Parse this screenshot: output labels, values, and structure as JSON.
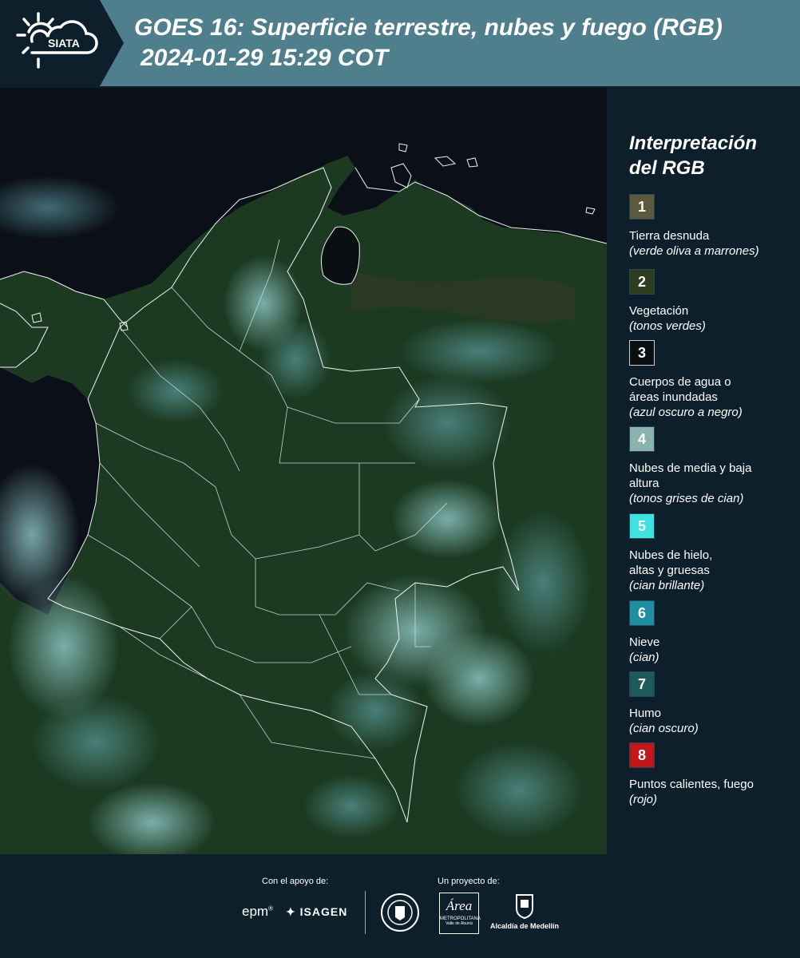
{
  "header": {
    "logo_text": "SIATA",
    "title_line1": "GOES 16: Superficie terrestre, nubes y fuego (RGB)",
    "title_line2": "2024-01-29 15:29 COT"
  },
  "legend": {
    "title_line1": "Interpretación",
    "title_line2": "del RGB",
    "items": [
      {
        "number": "1",
        "color": "#5c5a3e",
        "label": "Tierra desnuda",
        "note": "(verde oliva a marrones)"
      },
      {
        "number": "2",
        "color": "#2b3d1c",
        "label": "Vegetación",
        "note": "(tonos verdes)"
      },
      {
        "number": "3",
        "color": "#0b0f12",
        "label": "Cuerpos de agua o áreas inundadas",
        "note": "(azul oscuro a negro)"
      },
      {
        "number": "4",
        "color": "#8ab3b0",
        "label": "Nubes de media y baja altura",
        "note": "(tonos grises de cian)"
      },
      {
        "number": "5",
        "color": "#3ee3e0",
        "label": "Nubes de hielo, altas y gruesas",
        "note": "(cian brillante)"
      },
      {
        "number": "6",
        "color": "#1f8ea3",
        "label": "Nieve",
        "note": "(cian)"
      },
      {
        "number": "7",
        "color": "#1c5a5c",
        "label": "Humo",
        "note": "(cian oscuro)"
      },
      {
        "number": "8",
        "color": "#c3161b",
        "label": "Puntos calientes, fuego",
        "note": "(rojo)"
      }
    ]
  },
  "footer": {
    "support_label": "Con el apoyo de:",
    "project_label": "Un proyecto de:",
    "epm": "epm",
    "isagen": "ISAGEN",
    "area_brand": "Área",
    "area_sub": "METROPOLITANA",
    "area_sub2": "Valle de Aburrá",
    "alcaldia": "Alcaldía de Medellín"
  }
}
